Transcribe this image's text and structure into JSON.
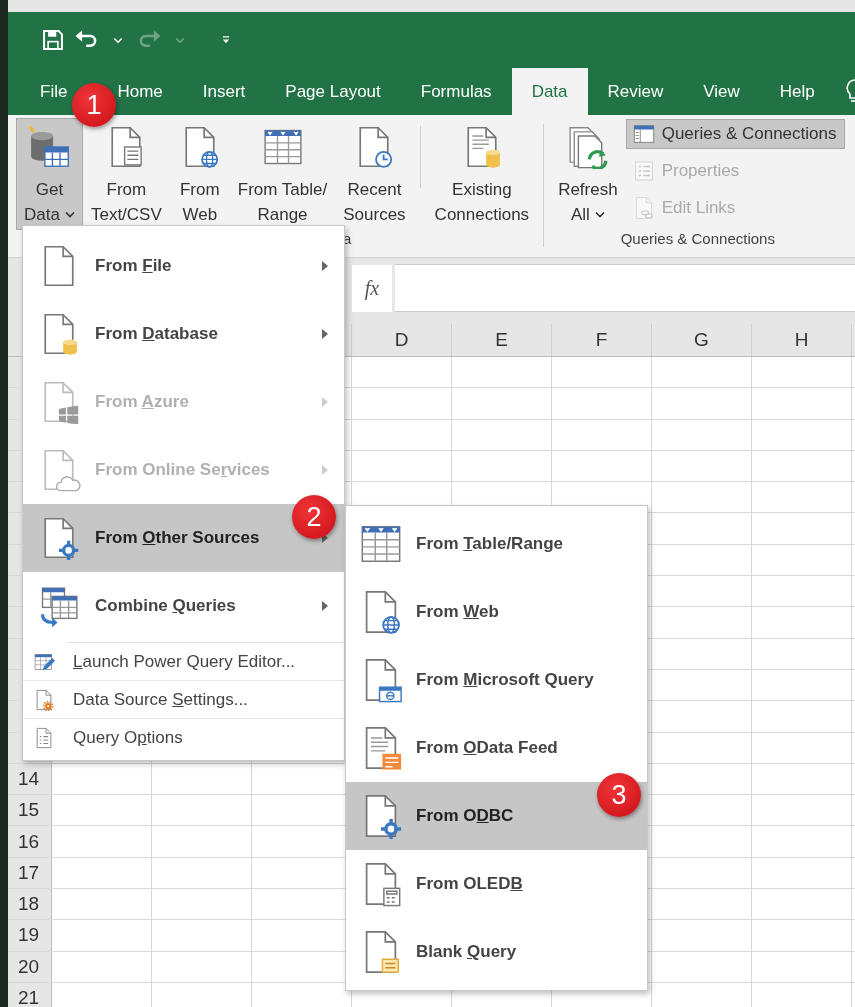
{
  "quick_access": [
    {
      "kind": "save",
      "disabled": false
    },
    {
      "kind": "undo",
      "disabled": false
    },
    {
      "kind": "caret",
      "disabled": false
    },
    {
      "kind": "redo",
      "disabled": true
    },
    {
      "kind": "caret",
      "disabled": true
    },
    {
      "kind": "customize",
      "disabled": false
    }
  ],
  "tabs": [
    {
      "label": "File",
      "selected": false
    },
    {
      "label": "Home",
      "selected": false
    },
    {
      "label": "Insert",
      "selected": false
    },
    {
      "label": "Page Layout",
      "selected": false
    },
    {
      "label": "Formulas",
      "selected": false
    },
    {
      "label": "Data",
      "selected": true
    },
    {
      "label": "Review",
      "selected": false
    },
    {
      "label": "View",
      "selected": false
    },
    {
      "label": "Help",
      "selected": false
    }
  ],
  "ribbon": {
    "groups": [
      {
        "label": "a",
        "buttons": [
          {
            "kind": "get-data",
            "lines": [
              "Get",
              "Data"
            ],
            "dropdown": true,
            "pressed": true,
            "badge": "1"
          },
          {
            "kind": "text-csv",
            "lines": [
              "From",
              "Text/CSV"
            ],
            "dropdown": false,
            "pressed": false
          },
          {
            "kind": "web",
            "lines": [
              "From",
              "Web"
            ],
            "dropdown": false,
            "pressed": false
          },
          {
            "kind": "table-range",
            "lines": [
              "From Table/",
              "Range"
            ],
            "dropdown": false,
            "pressed": false
          },
          {
            "kind": "recent",
            "lines": [
              "Recent",
              "Sources"
            ],
            "dropdown": false,
            "pressed": false
          },
          {
            "kind": "separator"
          },
          {
            "kind": "existing",
            "lines": [
              "Existing",
              "Connections"
            ],
            "dropdown": false,
            "pressed": false
          }
        ]
      },
      {
        "label": "Queries & Connections",
        "buttons": [
          {
            "kind": "refresh",
            "lines": [
              "Refresh",
              "All"
            ],
            "dropdown": true,
            "pressed": false
          }
        ],
        "small_buttons": [
          {
            "kind": "queries",
            "label": "Queries & Connections",
            "pressed": true,
            "disabled": false
          },
          {
            "kind": "properties",
            "label": "Properties",
            "pressed": false,
            "disabled": true
          },
          {
            "kind": "edit-links",
            "label": "Edit Links",
            "pressed": false,
            "disabled": true
          }
        ]
      }
    ]
  },
  "formula_bar": {
    "function_label": "fx"
  },
  "sheet": {
    "columns": [
      "D",
      "E",
      "F",
      "G",
      "H"
    ],
    "rows": [
      "14",
      "15",
      "16",
      "17",
      "18",
      "19",
      "20",
      "21"
    ]
  },
  "menu": {
    "items": [
      {
        "kind": "file",
        "label": [
          {
            "text": "From ",
            "underlined": false
          },
          {
            "text": "F",
            "underlined": true
          },
          {
            "text": "ile",
            "underlined": false
          }
        ],
        "disabled": false,
        "selected": false,
        "has_submenu": true
      },
      {
        "kind": "database",
        "label": [
          {
            "text": "From ",
            "underlined": false
          },
          {
            "text": "D",
            "underlined": true
          },
          {
            "text": "atabase",
            "underlined": false
          }
        ],
        "disabled": false,
        "selected": false,
        "has_submenu": true
      },
      {
        "kind": "azure",
        "label": [
          {
            "text": "From ",
            "underlined": false
          },
          {
            "text": "A",
            "underlined": true
          },
          {
            "text": "zure",
            "underlined": false
          }
        ],
        "disabled": true,
        "selected": false,
        "has_submenu": true
      },
      {
        "kind": "online",
        "label": [
          {
            "text": "From Online Se",
            "underlined": false
          },
          {
            "text": "r",
            "underlined": true
          },
          {
            "text": "vices",
            "underlined": false
          }
        ],
        "disabled": true,
        "selected": false,
        "has_submenu": true
      },
      {
        "kind": "other",
        "label": [
          {
            "text": "From ",
            "underlined": false
          },
          {
            "text": "O",
            "underlined": true
          },
          {
            "text": "ther Sources",
            "underlined": false
          }
        ],
        "disabled": false,
        "selected": true,
        "has_submenu": true,
        "badge": "2"
      },
      {
        "kind": "combine",
        "label": [
          {
            "text": "Combine ",
            "underlined": false
          },
          {
            "text": "Q",
            "underlined": true
          },
          {
            "text": "ueries",
            "underlined": false
          }
        ],
        "disabled": false,
        "selected": false,
        "has_submenu": true
      }
    ],
    "commands": [
      {
        "kind": "launch",
        "label": [
          {
            "text": "L",
            "underlined": true
          },
          {
            "text": "aunch Power Query Editor...",
            "underlined": false
          }
        ]
      },
      {
        "kind": "settings",
        "label": [
          {
            "text": "Data Source ",
            "underlined": false
          },
          {
            "text": "S",
            "underlined": true
          },
          {
            "text": "ettings...",
            "underlined": false
          }
        ]
      },
      {
        "kind": "options",
        "label": [
          {
            "text": "Query O",
            "underlined": false
          },
          {
            "text": "p",
            "underlined": true
          },
          {
            "text": "tions",
            "underlined": false
          }
        ]
      }
    ]
  },
  "submenu": {
    "items": [
      {
        "kind": "table-range",
        "label": [
          {
            "text": "From ",
            "underlined": false
          },
          {
            "text": "T",
            "underlined": true
          },
          {
            "text": "able/Range",
            "underlined": false
          }
        ],
        "selected": false
      },
      {
        "kind": "web",
        "label": [
          {
            "text": "From ",
            "underlined": false
          },
          {
            "text": "W",
            "underlined": true
          },
          {
            "text": "eb",
            "underlined": false
          }
        ],
        "selected": false
      },
      {
        "kind": "msquery",
        "label": [
          {
            "text": "From ",
            "underlined": false
          },
          {
            "text": "M",
            "underlined": true
          },
          {
            "text": "icrosoft Query",
            "underlined": false
          }
        ],
        "selected": false
      },
      {
        "kind": "odata",
        "label": [
          {
            "text": "From ",
            "underlined": false
          },
          {
            "text": "O",
            "underlined": true
          },
          {
            "text": "Data Feed",
            "underlined": false
          }
        ],
        "selected": false
      },
      {
        "kind": "other",
        "label": [
          {
            "text": "From O",
            "underlined": false
          },
          {
            "text": "D",
            "underlined": true
          },
          {
            "text": "BC",
            "underlined": false
          }
        ],
        "selected": true,
        "badge": "3"
      },
      {
        "kind": "oledb",
        "label": [
          {
            "text": "From OLED",
            "underlined": false
          },
          {
            "text": "B",
            "underlined": true
          }
        ],
        "selected": false
      },
      {
        "kind": "blank",
        "label": [
          {
            "text": "Blank ",
            "underlined": false
          },
          {
            "text": "Q",
            "underlined": true
          },
          {
            "text": "uery",
            "underlined": false
          }
        ],
        "selected": false
      }
    ]
  }
}
